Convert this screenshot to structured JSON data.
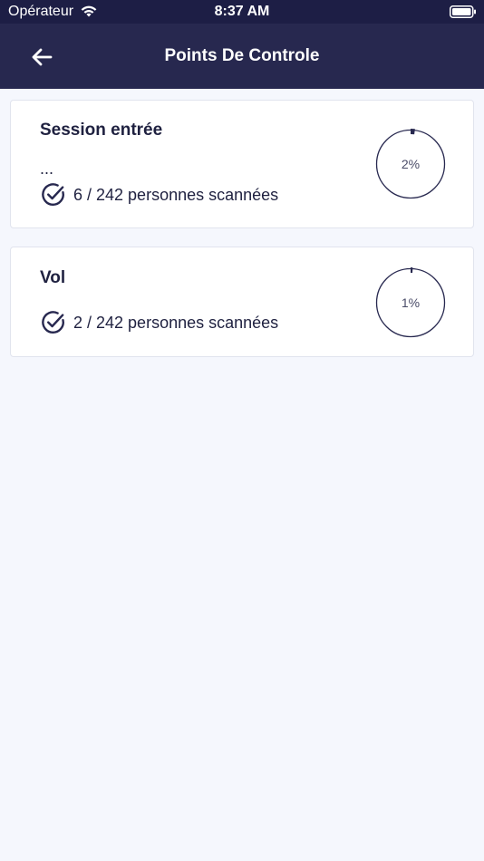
{
  "status_bar": {
    "carrier": "Opérateur",
    "time": "8:37 AM"
  },
  "nav": {
    "title": "Points De Controle"
  },
  "colors": {
    "header": "#27284f",
    "accent": "#27284f",
    "background": "#f5f7fd"
  },
  "checkpoints": [
    {
      "title": "Session entrée",
      "subtitle": "...",
      "scanned_text": "6 / 242 personnes scannées",
      "percent_label": "2%",
      "progress": 0.02
    },
    {
      "title": "Vol",
      "scanned_text": "2 / 242 personnes scannées",
      "percent_label": "1%",
      "progress": 0.01
    }
  ]
}
